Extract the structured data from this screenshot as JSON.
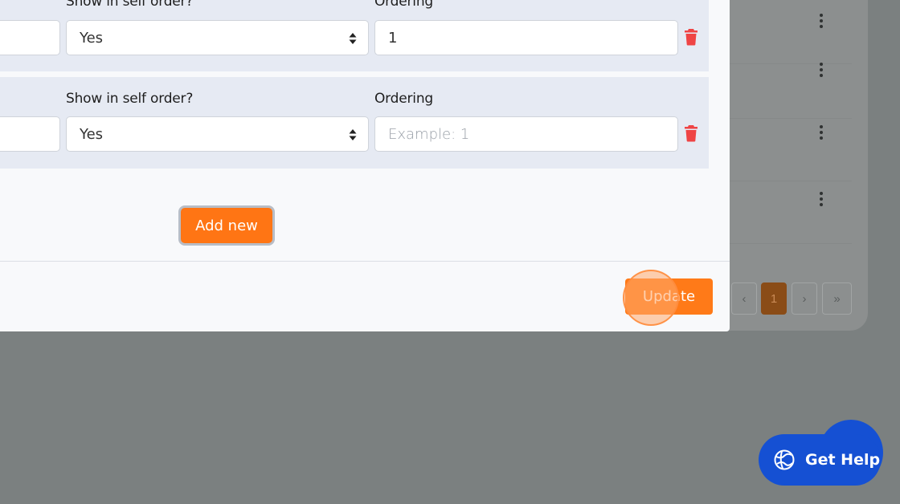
{
  "colors": {
    "accent": "#ff7514",
    "panel": "#e6eaf3",
    "help": "#1550d3",
    "danger": "#ef4444",
    "overlay": "#7b8080"
  },
  "rows": [
    {
      "show_label": "Show in self order?",
      "ordering_label": "Ordering",
      "show_value": "Yes",
      "ordering_value": "1",
      "ordering_placeholder": ""
    },
    {
      "show_label": "Show in self order?",
      "ordering_label": "Ordering",
      "show_value": "Yes",
      "ordering_value": "",
      "ordering_placeholder": "Example: 1"
    }
  ],
  "actions": {
    "add_new_label": "Add new",
    "update_label": "Update"
  },
  "pagination": {
    "prev_label": "‹",
    "current_page": "1",
    "next_label": "›",
    "last_label": "»"
  },
  "help": {
    "label": "Get Help",
    "icon": "globe-icon"
  }
}
